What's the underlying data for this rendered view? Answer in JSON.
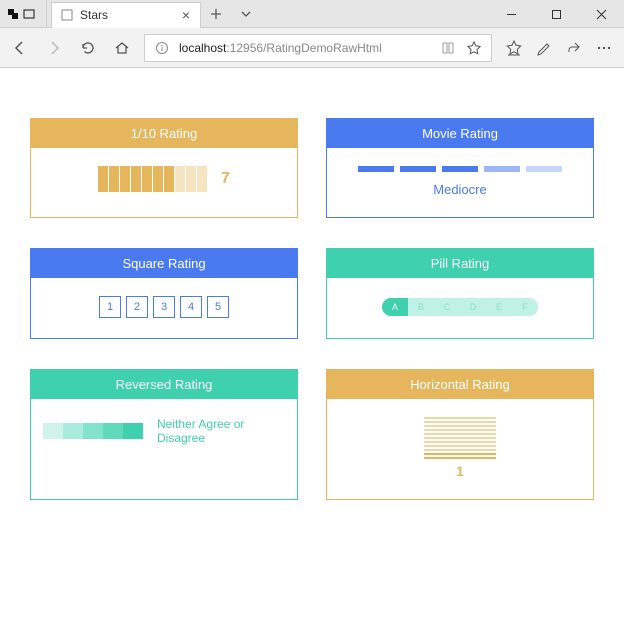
{
  "window": {
    "tab_title": "Stars"
  },
  "address": {
    "host": "localhost",
    "rest": ":12956/RatingDemoRawHtml"
  },
  "cards": {
    "ten": {
      "title": "1/10 Rating",
      "value": "7",
      "filled": 7,
      "total": 10
    },
    "movie": {
      "title": "Movie Rating",
      "label": "Mediocre"
    },
    "square": {
      "title": "Square Rating",
      "items": [
        "1",
        "2",
        "3",
        "4",
        "5"
      ]
    },
    "pill": {
      "title": "Pill Rating",
      "items": [
        "A",
        "B",
        "C",
        "D",
        "E",
        "F"
      ],
      "filled": 1
    },
    "reversed": {
      "title": "Reversed Rating",
      "label": "Neither Agree or Disagree"
    },
    "horizontal": {
      "title": "Horizontal Rating",
      "value": "1"
    }
  }
}
